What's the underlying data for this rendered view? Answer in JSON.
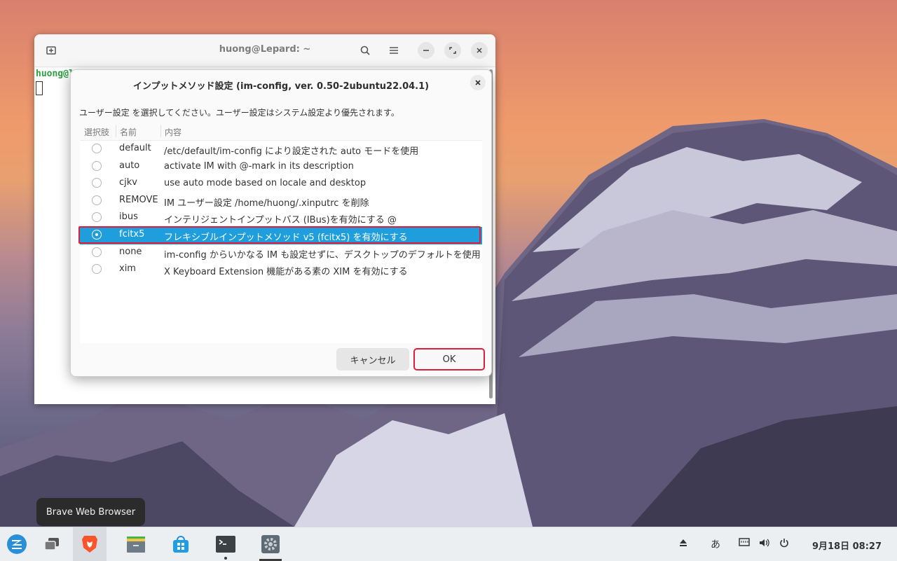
{
  "terminal": {
    "title": "huong@Lepard: ~",
    "prompt": "huong@l"
  },
  "dialog": {
    "title": "インプットメソッド設定 (im-config, ver. 0.50-2ubuntu22.04.1)",
    "message": "ユーザー設定 を選択してください。ユーザー設定はシステム設定より優先されます。",
    "columns": {
      "choice": "選択肢",
      "name": "名前",
      "desc": "内容"
    },
    "rows": [
      {
        "name": "default",
        "desc": "/etc/default/im-config により設定された auto モードを使用"
      },
      {
        "name": "auto",
        "desc": "activate IM with @-mark in its description"
      },
      {
        "name": "cjkv",
        "desc": "use auto mode based on locale and desktop"
      },
      {
        "name": "REMOVE",
        "desc": "IM ユーザー設定 /home/huong/.xinputrc を削除"
      },
      {
        "name": "ibus",
        "desc": "インテリジェントインプットバス (IBus)を有効にする @"
      },
      {
        "name": "fcitx5",
        "desc": "フレキシブルインプットメソッド v5 (fcitx5) を有効にする"
      },
      {
        "name": "none",
        "desc": "im-config からいかなる IM も設定せずに、デスクトップのデフォルトを使用"
      },
      {
        "name": "xim",
        "desc": "X Keyboard Extension 機能がある素の XIM を有効にする"
      }
    ],
    "selected_index": 5,
    "cancel_label": "キャンセル",
    "ok_label": "OK"
  },
  "tooltip": "Brave Web Browser",
  "tray": {
    "ime": "あ",
    "clock": "9月18日 08:27"
  },
  "icons": {
    "menu": "zorin-logo-icon",
    "windows": "show-windows-icon",
    "browser": "brave-lion-icon",
    "files": "files-icon",
    "store": "software-store-icon",
    "terminal": "terminal-icon",
    "settings": "settings-gear-icon"
  }
}
